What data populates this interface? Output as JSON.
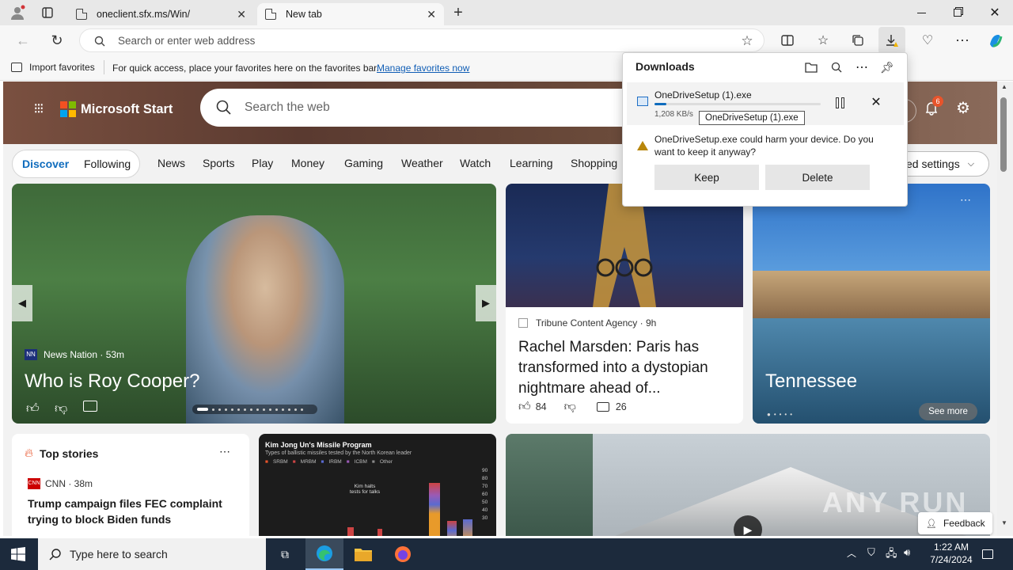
{
  "browser": {
    "tabs": [
      {
        "title": "oneclient.sfx.ms/Win/",
        "active": false
      },
      {
        "title": "New tab",
        "active": true
      }
    ],
    "address_placeholder": "Search or enter web address",
    "favorites_bar": {
      "import_label": "Import favorites",
      "hint": "For quick access, place your favorites here on the favorites bar.",
      "manage_link": "Manage favorites now"
    }
  },
  "downloads": {
    "title": "Downloads",
    "file_name": "OneDriveSetup (1).exe",
    "speed": "1,208 KB/s",
    "tooltip": "OneDriveSetup (1).exe",
    "warning": "OneDriveSetup.exe could harm your device. Do you want to keep it anyway?",
    "keep_label": "Keep",
    "delete_label": "Delete",
    "progress": 0.07
  },
  "ms_start": {
    "brand": "Microsoft Start",
    "search_placeholder": "Search the web",
    "notification_count": "6",
    "nav": {
      "discover": "Discover",
      "following": "Following",
      "items": [
        "News",
        "Sports",
        "Play",
        "Money",
        "Gaming",
        "Weather",
        "Watch",
        "Learning",
        "Shopping"
      ],
      "settings_label": "ed settings"
    },
    "hero": {
      "source": "News Nation",
      "age": "53m",
      "headline": "Who is Roy Cooper?"
    },
    "card2": {
      "source": "Tribune Content Agency",
      "age": "9h",
      "headline": "Rachel Marsden: Paris has transformed into a dystopian nightmare ahead of...",
      "likes": "84",
      "comments": "26"
    },
    "card3": {
      "title": "Tennessee",
      "see_more": "See more"
    },
    "top_stories": {
      "title": "Top stories",
      "source": "CNN",
      "age": "38m",
      "headline": "Trump campaign files FEC complaint trying to block Biden funds transferring..."
    },
    "missile_chart": {
      "title": "Kim Jong Un's Missile Program",
      "subtitle": "Types of ballistic missiles tested by the North Korean leader",
      "legend": [
        "SRBM",
        "MRBM",
        "IRBM",
        "ICBM",
        "Other"
      ],
      "annotation": "Kim halts tests for talks",
      "yticks": [
        "90",
        "80",
        "70",
        "60",
        "50",
        "40",
        "30"
      ]
    },
    "feedback_label": "Feedback",
    "watermark": "ANY RUN"
  },
  "taskbar": {
    "search_placeholder": "Type here to search",
    "time": "1:22 AM",
    "date": "7/24/2024"
  },
  "colors": {
    "accent": "#0f6cbd",
    "taskbar": "#1c2a3c",
    "badge": "#e8542b"
  }
}
